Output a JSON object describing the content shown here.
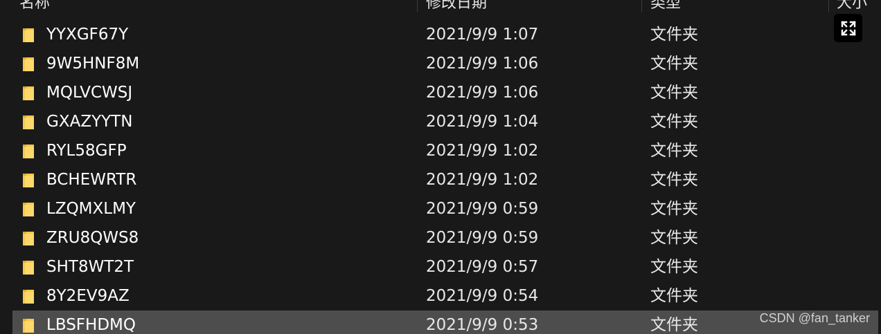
{
  "header": {
    "columns": [
      {
        "label": "名称"
      },
      {
        "label": "修改日期"
      },
      {
        "label": "类型"
      },
      {
        "label": "大小"
      }
    ]
  },
  "files": [
    {
      "name": "YYXGF67Y",
      "date": "2021/9/9 1:07",
      "type": "文件夹"
    },
    {
      "name": "9W5HNF8M",
      "date": "2021/9/9 1:06",
      "type": "文件夹"
    },
    {
      "name": "MQLVCWSJ",
      "date": "2021/9/9 1:06",
      "type": "文件夹"
    },
    {
      "name": "GXAZYYTN",
      "date": "2021/9/9 1:04",
      "type": "文件夹"
    },
    {
      "name": "RYL58GFP",
      "date": "2021/9/9 1:02",
      "type": "文件夹"
    },
    {
      "name": "BCHEWRTR",
      "date": "2021/9/9 1:02",
      "type": "文件夹"
    },
    {
      "name": "LZQMXLMY",
      "date": "2021/9/9 0:59",
      "type": "文件夹"
    },
    {
      "name": "ZRU8QWS8",
      "date": "2021/9/9 0:59",
      "type": "文件夹"
    },
    {
      "name": "SHT8WT2T",
      "date": "2021/9/9 0:57",
      "type": "文件夹"
    },
    {
      "name": "8Y2EV9AZ",
      "date": "2021/9/9 0:54",
      "type": "文件夹"
    },
    {
      "name": "LBSFHDMQ",
      "date": "2021/9/9 0:53",
      "type": "文件夹",
      "selected": true
    }
  ],
  "icons": {
    "folder": "folder-icon",
    "expand": "expand-icon"
  },
  "colors": {
    "background": "#191919",
    "selected_row": "#4d4d4d",
    "folder_yellow": "#f7c948"
  },
  "watermark": "CSDN @fan_tanker"
}
